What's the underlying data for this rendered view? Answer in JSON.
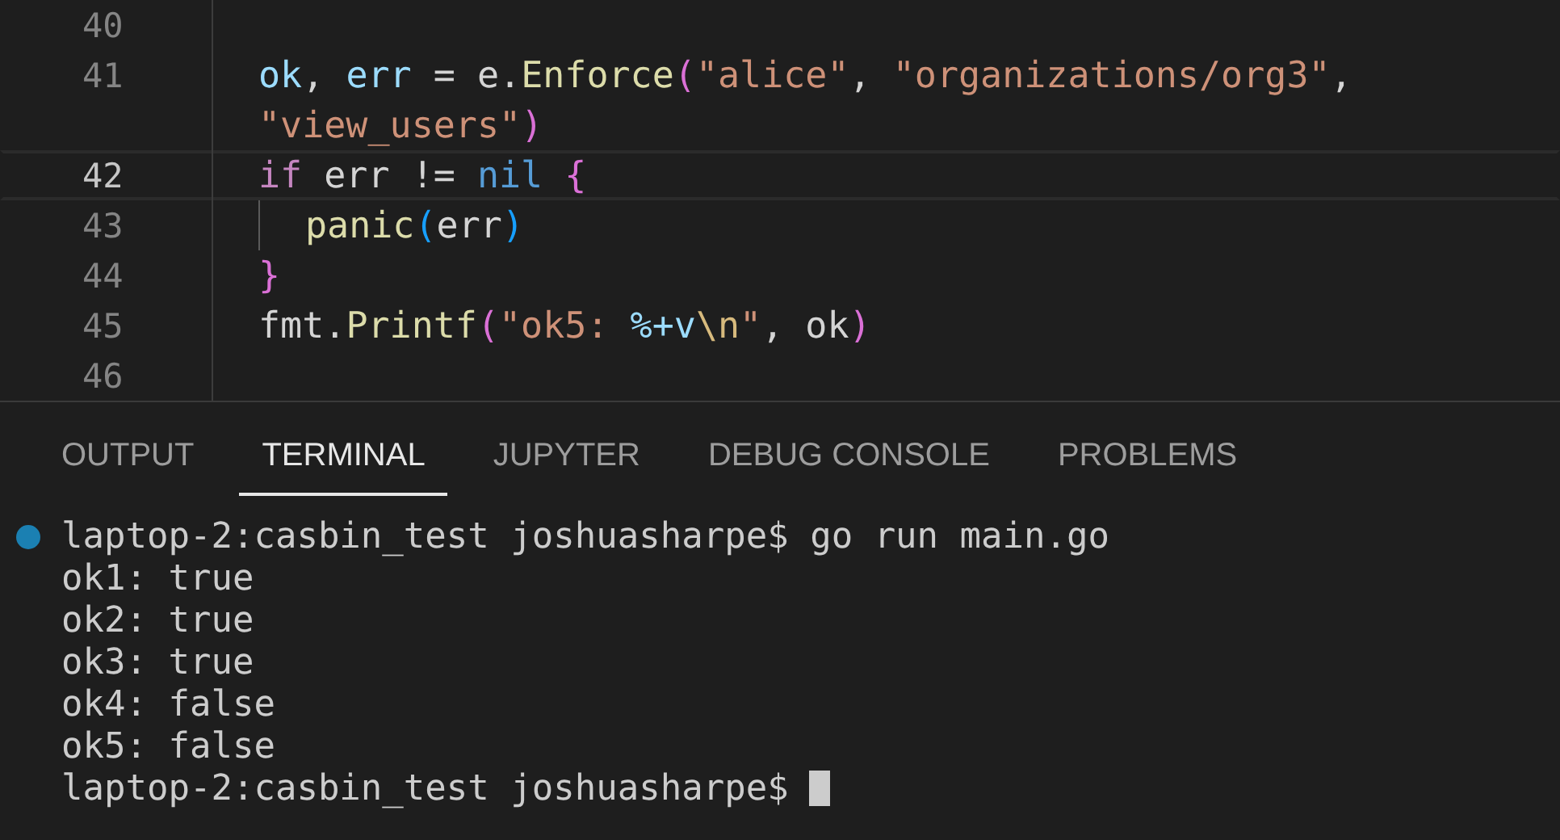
{
  "editor": {
    "lines": [
      {
        "number": "40",
        "current": false,
        "indent_guide": false
      },
      {
        "number": "41",
        "current": false,
        "indent_guide": false,
        "tokens": [
          {
            "text": "ok",
            "kind": "var"
          },
          {
            "text": ", ",
            "kind": "plain"
          },
          {
            "text": "err",
            "kind": "var"
          },
          {
            "text": " = e.",
            "kind": "plain"
          },
          {
            "text": "Enforce",
            "kind": "func"
          },
          {
            "text": "(",
            "kind": "bracket1"
          },
          {
            "text": "\"alice\"",
            "kind": "string"
          },
          {
            "text": ", ",
            "kind": "plain"
          },
          {
            "text": "\"organizations/org3\"",
            "kind": "string"
          },
          {
            "text": ",",
            "kind": "plain"
          }
        ]
      },
      {
        "current": false,
        "indent_guide": false,
        "tokens": [
          {
            "text": "\"view_users\"",
            "kind": "string"
          },
          {
            "text": ")",
            "kind": "bracket1"
          }
        ]
      },
      {
        "number": "42",
        "current": true,
        "indent_guide": false,
        "tokens": [
          {
            "text": "if",
            "kind": "keyword"
          },
          {
            "text": " err != ",
            "kind": "plain"
          },
          {
            "text": "nil",
            "kind": "const"
          },
          {
            "text": " {",
            "kind": "bracket1"
          }
        ]
      },
      {
        "number": "43",
        "current": false,
        "indent_guide": true,
        "tokens": [
          {
            "text": "panic",
            "kind": "func"
          },
          {
            "text": "(",
            "kind": "bracket2"
          },
          {
            "text": "err",
            "kind": "plain"
          },
          {
            "text": ")",
            "kind": "bracket2"
          }
        ]
      },
      {
        "number": "44",
        "current": false,
        "indent_guide": false,
        "tokens": [
          {
            "text": "}",
            "kind": "bracket1"
          }
        ]
      },
      {
        "number": "45",
        "current": false,
        "indent_guide": false,
        "tokens": [
          {
            "text": "fmt.",
            "kind": "plain"
          },
          {
            "text": "Printf",
            "kind": "func"
          },
          {
            "text": "(",
            "kind": "bracket1"
          },
          {
            "text": "\"ok5: ",
            "kind": "string"
          },
          {
            "text": "%+v",
            "kind": "var"
          },
          {
            "text": "\\n",
            "kind": "escape"
          },
          {
            "text": "\"",
            "kind": "string"
          },
          {
            "text": ", ok",
            "kind": "plain"
          },
          {
            "text": ")",
            "kind": "bracket1"
          }
        ]
      },
      {
        "number": "46",
        "current": false,
        "indent_guide": false
      }
    ]
  },
  "panel": {
    "tabs": [
      {
        "label": "OUTPUT",
        "selected": false
      },
      {
        "label": "TERMINAL",
        "selected": true
      },
      {
        "label": "JUPYTER",
        "selected": false
      },
      {
        "label": "DEBUG CONSOLE",
        "selected": false
      },
      {
        "label": "PROBLEMS",
        "selected": false
      }
    ],
    "terminal": [
      {
        "kind": "command",
        "text": "laptop-2:casbin_test joshuasharpe$ go run main.go"
      },
      {
        "kind": "output",
        "text": "ok1: true"
      },
      {
        "kind": "output",
        "text": "ok2: true"
      },
      {
        "kind": "output",
        "text": "ok3: true"
      },
      {
        "kind": "output",
        "text": "ok4: false"
      },
      {
        "kind": "output",
        "text": "ok5: false"
      },
      {
        "kind": "prompt",
        "text": "laptop-2:casbin_test joshuasharpe$"
      }
    ]
  }
}
